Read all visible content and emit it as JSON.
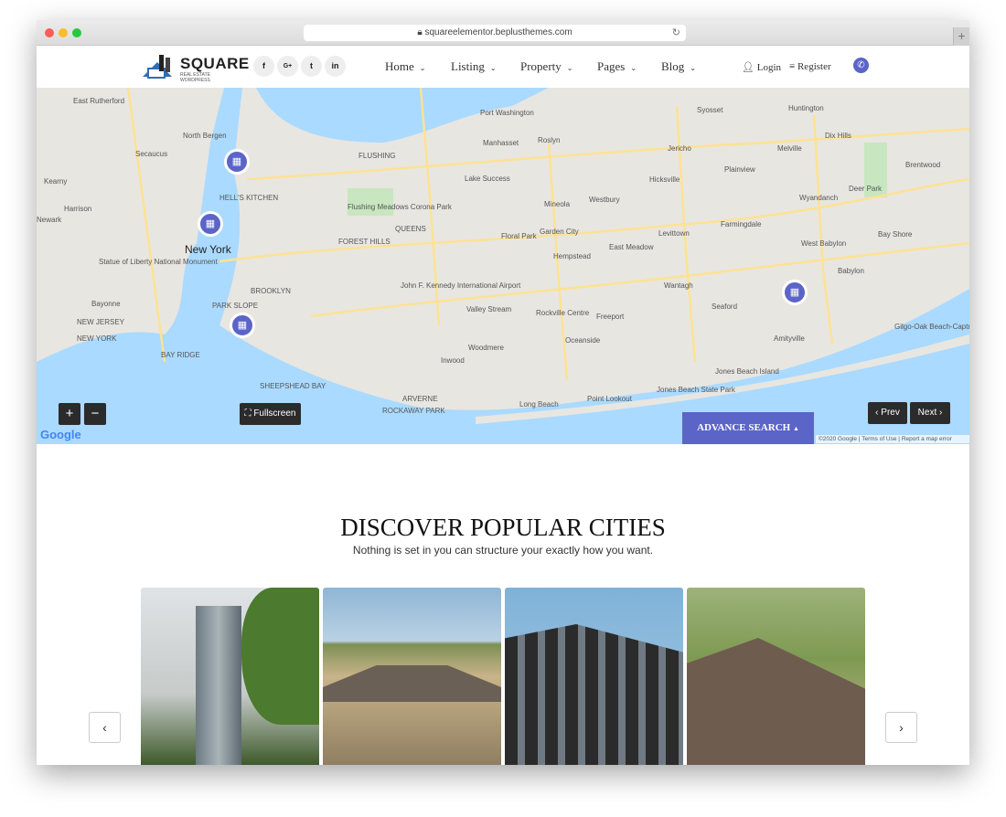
{
  "browser": {
    "url": "squareelementor.beplusthemes.com"
  },
  "header": {
    "logo": {
      "title": "SQUARE",
      "subtitle": "REAL ESTATE WORDPRESS"
    },
    "social": [
      "f",
      "G+",
      "t",
      "in"
    ],
    "nav": [
      {
        "label": "Home"
      },
      {
        "label": "Listing"
      },
      {
        "label": "Property"
      },
      {
        "label": "Pages"
      },
      {
        "label": "Blog"
      }
    ],
    "login": "Login",
    "register": "Register"
  },
  "map": {
    "labels": [
      "East Rutherford",
      "North Bergen",
      "Secaucus",
      "Kearny",
      "Harrison",
      "Newark",
      "New York",
      "Statue of Liberty National Monument",
      "Bayonne",
      "NEW JERSEY",
      "NEW YORK",
      "BROOKLYN",
      "PARK SLOPE",
      "BAY RIDGE",
      "SHEEPSHEAD BAY",
      "FLUSHING",
      "Flushing Meadows Corona Park",
      "QUEENS",
      "FOREST HILLS",
      "John F. Kennedy International Airport",
      "Valley Stream",
      "Floral Park",
      "Manhasset",
      "Port Washington",
      "Mineola",
      "Hempstead",
      "Garden City",
      "Westbury",
      "Hicksville",
      "Levittown",
      "Freeport",
      "Oceanside",
      "Long Beach",
      "Point Lookout",
      "Jones Beach State Park",
      "Wantagh",
      "Seaford",
      "Farmingdale",
      "Amityville",
      "West Babylon",
      "Babylon",
      "Bay Shore",
      "Huntington",
      "Melville",
      "Brentwood",
      "Dix Hills",
      "Deer Park",
      "Wyandanch",
      "Plainview",
      "Jericho",
      "Syosset",
      "Woodmere",
      "Inwood",
      "ARVERNE",
      "ROCKAWAY PARK",
      "Rockville Centre",
      "East Meadow",
      "Lake Success",
      "Roslyn",
      "Gilgo-Oak Beach-Captree",
      "Jones Beach Island",
      "HELL'S KITCHEN"
    ],
    "zoom_in": "+",
    "zoom_out": "−",
    "fullscreen": "Fullscreen",
    "prev": "Prev",
    "next": "Next",
    "advance_search": "ADVANCE SEARCH",
    "google": "Google",
    "copyright": "©2020 Google",
    "terms": "Terms of Use",
    "report": "Report a map error",
    "colors": {
      "water": "#aadaff",
      "land": "#e8e6e1",
      "road": "#fde293",
      "park": "#c8e6c0"
    }
  },
  "section": {
    "title": "DISCOVER POPULAR CITIES",
    "subtitle": "Nothing is set in you can structure your exactly how you want."
  },
  "accent": "#5b64c7"
}
